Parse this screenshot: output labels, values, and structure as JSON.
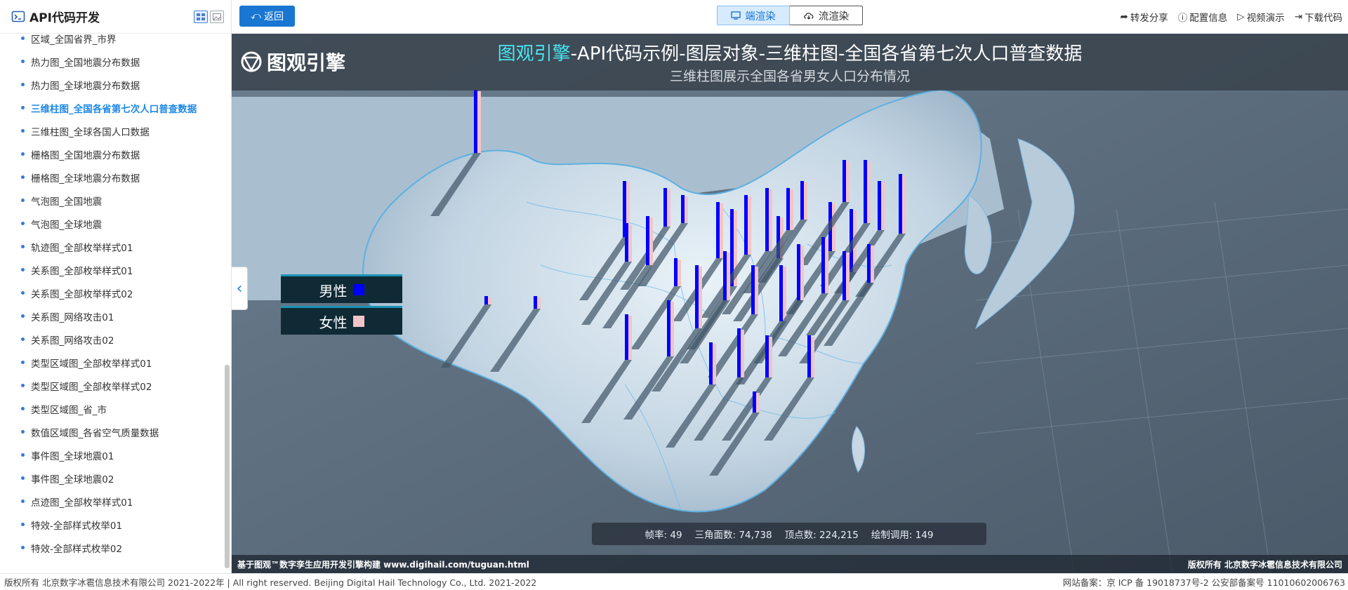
{
  "sidebar": {
    "title": "API代码开发",
    "items": [
      {
        "label": "区域_全国省界_市界",
        "active": false
      },
      {
        "label": "热力图_全国地震分布数据",
        "active": false
      },
      {
        "label": "热力图_全球地震分布数据",
        "active": false
      },
      {
        "label": "三维柱图_全国各省第七次人口普查数据",
        "active": true
      },
      {
        "label": "三维柱图_全球各国人口数据",
        "active": false
      },
      {
        "label": "栅格图_全国地震分布数据",
        "active": false
      },
      {
        "label": "栅格图_全球地震分布数据",
        "active": false
      },
      {
        "label": "气泡图_全国地震",
        "active": false
      },
      {
        "label": "气泡图_全球地震",
        "active": false
      },
      {
        "label": "轨迹图_全部枚举样式01",
        "active": false
      },
      {
        "label": "关系图_全部枚举样式01",
        "active": false
      },
      {
        "label": "关系图_全部枚举样式02",
        "active": false
      },
      {
        "label": "关系图_网络攻击01",
        "active": false
      },
      {
        "label": "关系图_网络攻击02",
        "active": false
      },
      {
        "label": "类型区域图_全部枚举样式01",
        "active": false
      },
      {
        "label": "类型区域图_全部枚举样式02",
        "active": false
      },
      {
        "label": "类型区域图_省_市",
        "active": false
      },
      {
        "label": "数值区域图_各省空气质量数据",
        "active": false
      },
      {
        "label": "事件图_全球地震01",
        "active": false
      },
      {
        "label": "事件图_全球地震02",
        "active": false
      },
      {
        "label": "点迹图_全部枚举样式01",
        "active": false
      },
      {
        "label": "特效-全部样式枚举01",
        "active": false
      },
      {
        "label": "特效-全部样式枚举02",
        "active": false
      }
    ]
  },
  "topbar": {
    "back_label": "返回",
    "client_render_label": "端渲染",
    "stream_render_label": "流渲染",
    "share_label": "转发分享",
    "config_label": "配置信息",
    "video_label": "视频演示",
    "download_label": "下载代码"
  },
  "map": {
    "logo_text": "图观引擎",
    "title_highlight": "图观引擎",
    "title_rest": "-API代码示例-图层对象-三维柱图-全国各省第七次人口普查数据",
    "subtitle": "三维柱图展示全国各省男女人口分布情况",
    "legend": [
      {
        "label": "男性",
        "color": "#0000ff"
      },
      {
        "label": "女性",
        "color": "#f2c4c8"
      }
    ],
    "stats": {
      "fps_label": "帧率:",
      "fps_value": "49",
      "tri_label": "三角面数:",
      "tri_value": "74,738",
      "vert_label": "顶点数:",
      "vert_value": "224,215",
      "draw_label": "绘制调用:",
      "draw_value": "149"
    },
    "footer_left": "基于图观™数字孪生应用开发引擎构建 www.digihail.com/tuguan.html",
    "footer_right": "版权所有 北京数字冰雹信息技术有限公司"
  },
  "footer": {
    "left": "版权所有 北京数字冰雹信息技术有限公司 2021-2022年 | All right reserved. Beijing Digital Hail Technology Co., Ltd. 2021-2022",
    "right": "网站备案：京 ICP 备 19018737号-2 公安部备案号 11010602006763"
  }
}
